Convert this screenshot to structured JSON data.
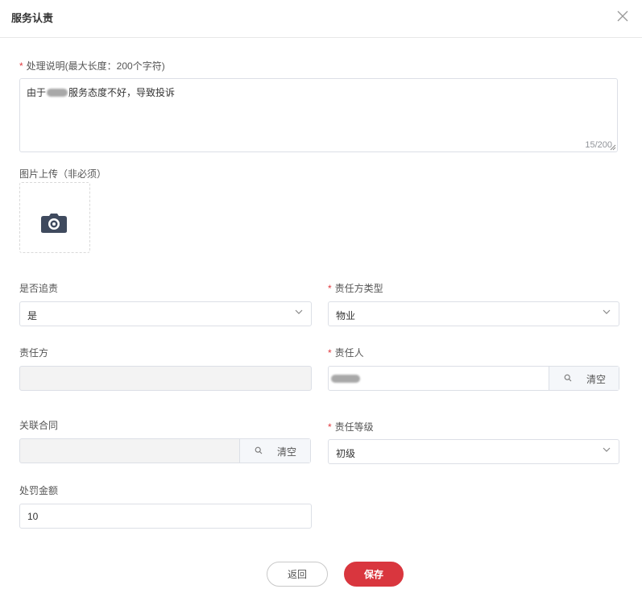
{
  "dialog": {
    "title": "服务认责"
  },
  "fields": {
    "description": {
      "label": "处理说明(最大长度：200个字符)",
      "required_mark": "*",
      "value_prefix": "由于",
      "value_suffix": "服务态度不好，导致投诉",
      "counter": "15/200"
    },
    "image_upload": {
      "label": "图片上传（非必须）"
    },
    "pursue": {
      "label": "是否追责",
      "value": "是"
    },
    "party_type": {
      "label": "责任方类型",
      "required_mark": "*",
      "value": "物业"
    },
    "party": {
      "label": "责任方",
      "value": ""
    },
    "person": {
      "label": "责任人",
      "required_mark": "*",
      "value": "",
      "clear_label": "清空"
    },
    "contract": {
      "label": "关联合同",
      "value": "",
      "clear_label": "清空"
    },
    "level": {
      "label": "责任等级",
      "required_mark": "*",
      "value": "初级"
    },
    "penalty": {
      "label": "处罚金额",
      "value": "10"
    }
  },
  "actions": {
    "back_label": "返回",
    "save_label": "保存"
  },
  "colors": {
    "primary": "#d9363e",
    "required": "#e0393e",
    "border": "#dcdfe6",
    "disabled_bg": "#f3f3f3"
  },
  "icons": [
    "close-icon",
    "camera-icon",
    "chevron-down-icon",
    "search-icon"
  ]
}
